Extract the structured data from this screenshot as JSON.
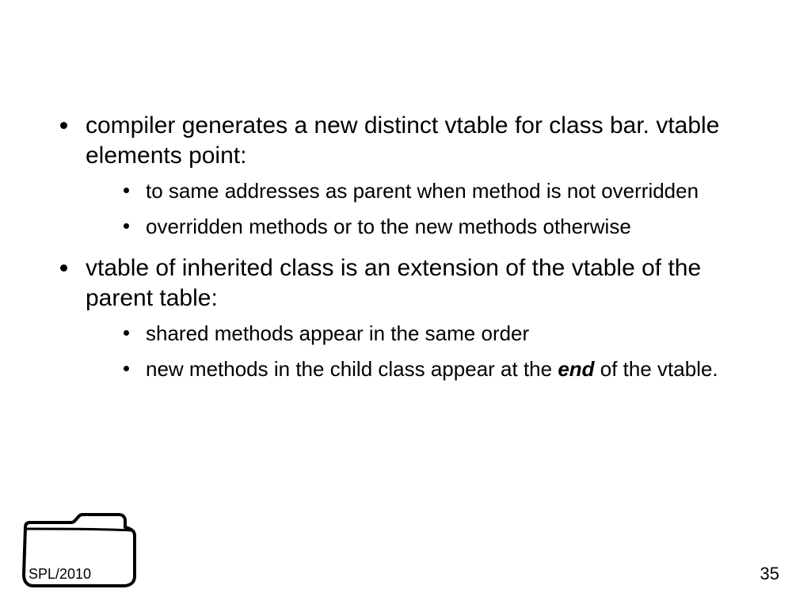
{
  "bullets": [
    {
      "text": "compiler generates a new distinct vtable for class bar.  vtable elements point:",
      "sub": [
        "to same addresses as parent when method is not overridden",
        "overridden methods or to the new methods otherwise"
      ]
    },
    {
      "text": "vtable of inherited class is an extension of the vtable of the parent table:",
      "sub": [
        "shared methods appear in the same order",
        {
          "pre": "new methods in the child class appear at the ",
          "em": "end",
          "post": " of the vtable."
        }
      ]
    }
  ],
  "footer_label": "SPL/2010",
  "page_number": "35"
}
